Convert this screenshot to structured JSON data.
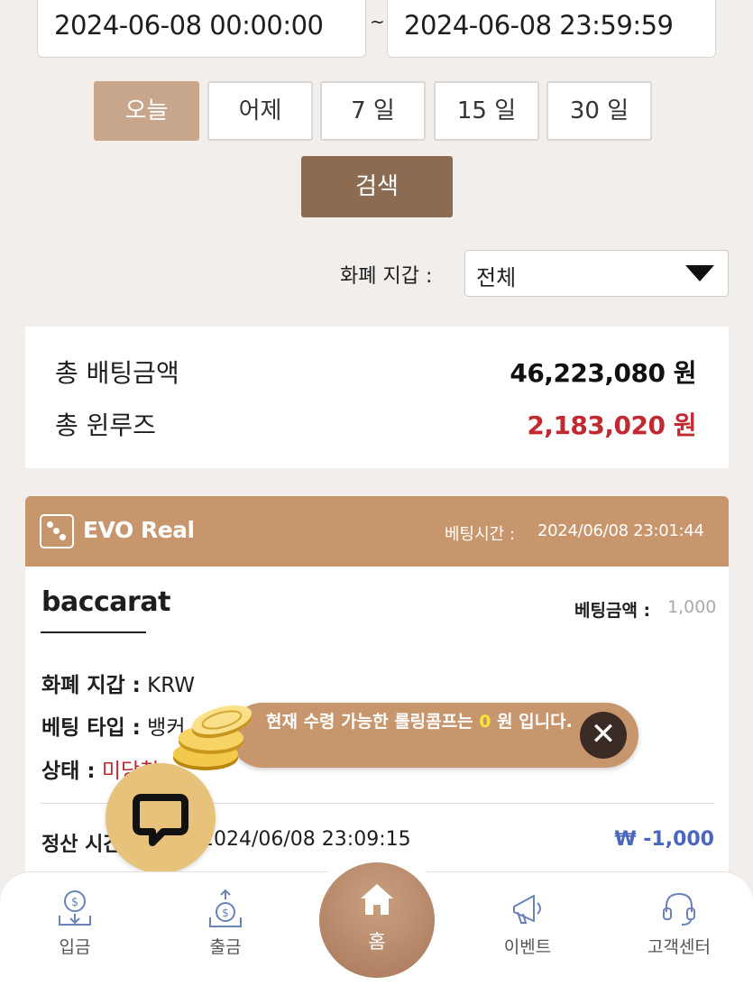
{
  "filters": {
    "date_from": "2024-06-08 00:00:00",
    "date_separator": "~",
    "date_to": "2024-06-08 23:59:59",
    "periods": [
      "오늘",
      "어제",
      "7 일",
      "15 일",
      "30 일"
    ],
    "active_period": "오늘",
    "search_label": "검색",
    "wallet_label": "화폐 지갑 :",
    "wallet_value": "전체"
  },
  "summary": {
    "total_bet_label": "총 배팅금액",
    "total_bet_value": "46,223,080 원",
    "total_win_label": "총 윈루즈",
    "total_win_value": "2,183,020 원"
  },
  "bet_card": {
    "provider": "EVO Real",
    "bet_time_label": "베팅시간 :",
    "bet_time_value": "2024/06/08 23:01:44",
    "game": "baccarat",
    "bet_amount_label": "베팅금액 :",
    "bet_amount_value": "1,000",
    "wallet_label": "화폐 지갑 :",
    "wallet_value": "KRW",
    "type_label": "베팅 타입 :",
    "type_value": "뱅커",
    "status_label": "상태 :",
    "status_value": "미당첨",
    "settle_label": "정산 시간",
    "settle_time": "2024/06/08 23:09:15",
    "settle_amount": "₩ -1,000"
  },
  "toast": {
    "text_before": "현재 수령 가능한 롤링콤프는 ",
    "amount": "0",
    "text_after": " 원 입니다."
  },
  "nav": {
    "deposit": "입금",
    "withdraw": "출금",
    "home": "홈",
    "event": "이벤트",
    "support": "고객센터"
  },
  "colors": {
    "accent": "#c8966c",
    "active_period": "#c7a68b",
    "search_button": "#8b6c52",
    "loss_red": "#c12a30",
    "settle_blue": "#4a67bd"
  }
}
